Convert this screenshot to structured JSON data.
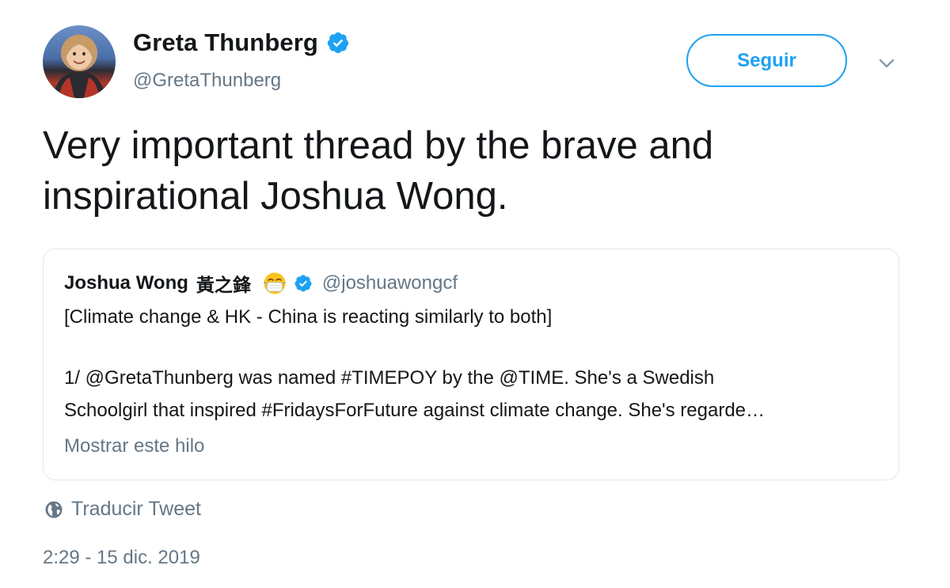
{
  "author": {
    "display_name": "Greta Thunberg",
    "handle": "@GretaThunberg",
    "verified": true
  },
  "actions": {
    "follow_label": "Seguir"
  },
  "tweet": {
    "text": "Very important thread by the brave and inspirational Joshua Wong."
  },
  "quoted_tweet": {
    "display_name": "Joshua Wong",
    "display_name_cjk": "黃之鋒",
    "emoji": "mask-emoji-icon",
    "verified": true,
    "handle": "@joshuawongcf",
    "line1": "[Climate change & HK - China is reacting similarly to both]",
    "line2": "1/ @GretaThunberg was named #TIMEPOY by the @TIME. She's a Swedish",
    "line3": "Schoolgirl that inspired #FridaysForFuture against climate change. She's regarde…",
    "show_thread": "Mostrar este hilo"
  },
  "translate": {
    "label": "Traducir Tweet"
  },
  "meta": {
    "timestamp": "2:29 - 15 dic. 2019"
  },
  "colors": {
    "accent": "#1da1f2",
    "secondary_text": "#657786",
    "primary_text": "#14171a",
    "border": "#e1e8ed"
  }
}
